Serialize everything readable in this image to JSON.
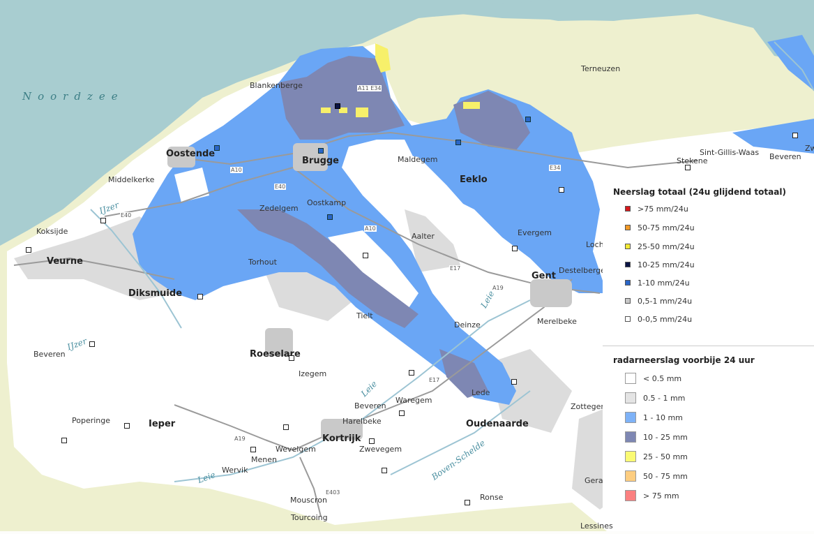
{
  "map": {
    "places": [
      {
        "name": "Noordzee",
        "cls": "sea"
      },
      {
        "name": "Blankenberge",
        "cls": ""
      },
      {
        "name": "Oostende",
        "cls": "big"
      },
      {
        "name": "Brugge",
        "cls": "big"
      },
      {
        "name": "Middelkerke",
        "cls": ""
      },
      {
        "name": "Zedelgem",
        "cls": ""
      },
      {
        "name": "Oostkamp",
        "cls": ""
      },
      {
        "name": "Maldegem",
        "cls": ""
      },
      {
        "name": "Eeklo",
        "cls": "big"
      },
      {
        "name": "Koksijde",
        "cls": ""
      },
      {
        "name": "Veurne",
        "cls": "big"
      },
      {
        "name": "Torhout",
        "cls": ""
      },
      {
        "name": "Aalter",
        "cls": ""
      },
      {
        "name": "Evergem",
        "cls": ""
      },
      {
        "name": "Gent",
        "cls": "big"
      },
      {
        "name": "Diksmuide",
        "cls": "big"
      },
      {
        "name": "Tielt",
        "cls": ""
      },
      {
        "name": "Deinze",
        "cls": ""
      },
      {
        "name": "Merelbeke",
        "cls": ""
      },
      {
        "name": "Beveren",
        "cls": ""
      },
      {
        "name": "Roeselare",
        "cls": "big"
      },
      {
        "name": "Izegem",
        "cls": ""
      },
      {
        "name": "Beveren",
        "cls": ""
      },
      {
        "name": "Waregem",
        "cls": ""
      },
      {
        "name": "Poperinge",
        "cls": ""
      },
      {
        "name": "Ieper",
        "cls": "big"
      },
      {
        "name": "Harelbeke",
        "cls": ""
      },
      {
        "name": "Kortrijk",
        "cls": "big"
      },
      {
        "name": "Oudenaarde",
        "cls": "big"
      },
      {
        "name": "Wevelgem",
        "cls": ""
      },
      {
        "name": "Zwevegem",
        "cls": ""
      },
      {
        "name": "Menen",
        "cls": ""
      },
      {
        "name": "Wervik",
        "cls": ""
      },
      {
        "name": "Mouscron",
        "cls": ""
      },
      {
        "name": "Tourcoing",
        "cls": ""
      },
      {
        "name": "Ronse",
        "cls": ""
      },
      {
        "name": "Lede",
        "cls": ""
      },
      {
        "name": "Zottegem",
        "cls": ""
      },
      {
        "name": "Lessines",
        "cls": ""
      },
      {
        "name": "Terneuzen",
        "cls": ""
      },
      {
        "name": "Sint-Gillis-Waas",
        "cls": ""
      },
      {
        "name": "Stekene",
        "cls": ""
      },
      {
        "name": "Beveren",
        "cls": ""
      },
      {
        "name": "Lochris",
        "cls": ""
      },
      {
        "name": "Destelberge",
        "cls": ""
      },
      {
        "name": "Gera",
        "cls": ""
      },
      {
        "name": "Zw",
        "cls": ""
      }
    ],
    "rivers": [
      "IJzer",
      "IJzer",
      "Leie",
      "Leie",
      "Leie",
      "Boven-Schelde"
    ],
    "roads": [
      "A10",
      "E40",
      "E40",
      "A10",
      "A11 E34",
      "E34",
      "E17",
      "A19",
      "E403",
      "A19",
      "E17"
    ]
  },
  "legend": {
    "stations_title": "Neerslag totaal (24u glijdend totaal)",
    "stations": [
      {
        "label": ">75 mm/24u",
        "color": "#d7191c"
      },
      {
        "label": "50-75 mm/24u",
        "color": "#f39a26"
      },
      {
        "label": "25-50 mm/24u",
        "color": "#f4ea35"
      },
      {
        "label": "10-25 mm/24u",
        "color": "#0b1446"
      },
      {
        "label": "1-10 mm/24u",
        "color": "#2a66c8"
      },
      {
        "label": "0,5-1 mm/24u",
        "color": "#c8c8c8"
      },
      {
        "label": "0-0,5 mm/24u",
        "color": "#ffffff"
      }
    ],
    "radar_title": "radarneerslag voorbije 24 uur",
    "radar": [
      {
        "label": "< 0.5 mm",
        "color": "#ffffff"
      },
      {
        "label": "0.5 - 1 mm",
        "color": "#e4e4e4"
      },
      {
        "label": "1 - 10 mm",
        "color": "#7eb2f7"
      },
      {
        "label": "10 - 25 mm",
        "color": "#7e87b3"
      },
      {
        "label": "25 - 50 mm",
        "color": "#fafa73"
      },
      {
        "label": "50 - 75 mm",
        "color": "#fdcd80"
      },
      {
        "label": "> 75 mm",
        "color": "#fb8080"
      }
    ]
  },
  "colors": {
    "sea": "#a8cdd0",
    "land_outside": "#eef0cf",
    "land_inside": "#ffffff",
    "rain_light": "#6aa6f5",
    "rain_medium": "#7e87b3",
    "rain_heavy": "#f7f06a",
    "drizzle": "#dcdcdc"
  }
}
